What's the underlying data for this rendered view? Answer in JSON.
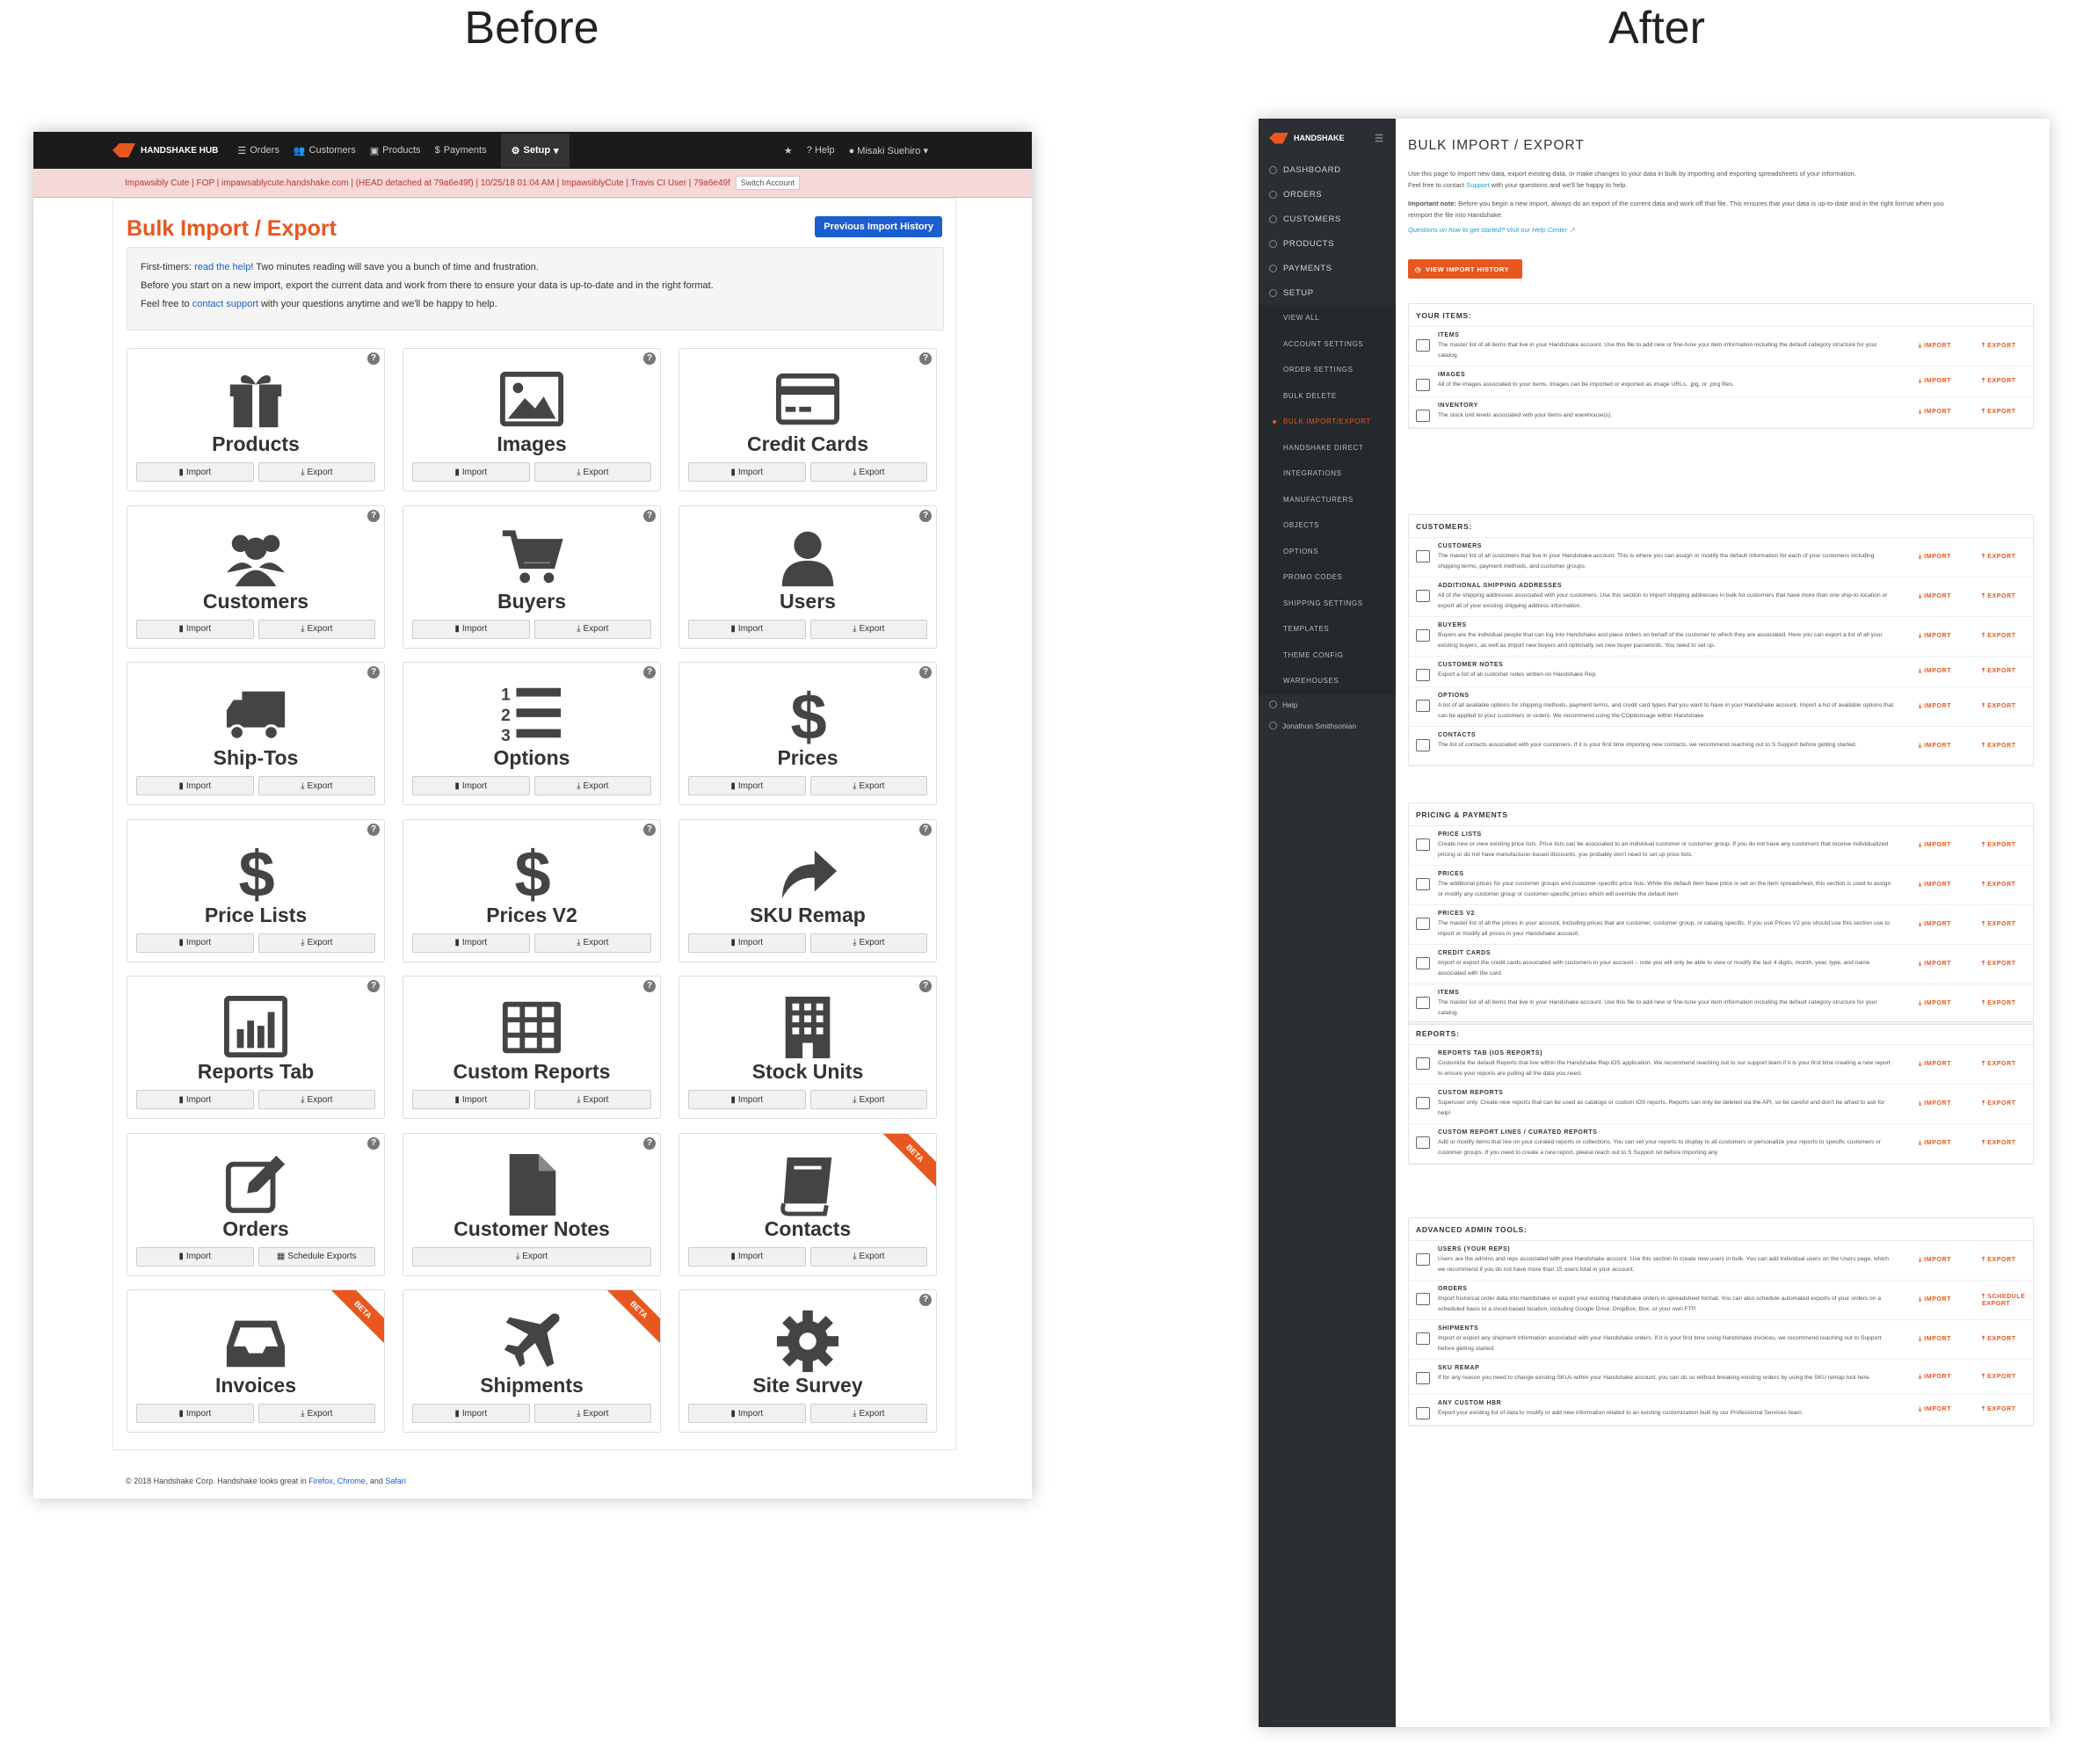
{
  "captions": {
    "before": "Before",
    "after": "After"
  },
  "before": {
    "brand": "HANDSHAKE HUB",
    "nav": [
      "Orders",
      "Customers",
      "Products",
      "Payments",
      "Setup"
    ],
    "nav_right": [
      "Help",
      "Misaki Suehiro"
    ],
    "env_bar": "Impawsibly Cute | FOP | impawsablycute.handshake.com | (HEAD detached at 79a6e49f) | 10/25/18 01:04 AM | ImpawsiblyCute | Travis CI User | 79a6e49f",
    "switch_account": "Switch Account",
    "title": "Bulk Import / Export",
    "history_button": "Previous Import History",
    "info": {
      "l1a": "First-timers: ",
      "l1link": "read the help",
      "l1b": "! Two minutes reading will save you a bunch of time and frustration.",
      "l2": "Before you start on a new import, export the current data and work from there to ensure your data is up-to-date and in the right format.",
      "l3a": "Feel free to ",
      "l3link": "contact support",
      "l3b": " with your questions anytime and we'll be happy to help."
    },
    "import_label": "Import",
    "export_label": "Export",
    "help_mark": "?",
    "beta_label": "BETA",
    "cards": [
      {
        "name": "Products",
        "icon": "gift-icon"
      },
      {
        "name": "Images",
        "icon": "image-icon"
      },
      {
        "name": "Credit Cards",
        "icon": "credit-card-icon"
      },
      {
        "name": "Customers",
        "icon": "group-icon"
      },
      {
        "name": "Buyers",
        "icon": "cart-icon"
      },
      {
        "name": "Users",
        "icon": "user-icon"
      },
      {
        "name": "Ship-Tos",
        "icon": "truck-icon"
      },
      {
        "name": "Options",
        "icon": "numbered-list-icon"
      },
      {
        "name": "Prices",
        "icon": "dollar-icon"
      },
      {
        "name": "Price Lists",
        "icon": "dollar-icon"
      },
      {
        "name": "Prices V2",
        "icon": "dollar-icon"
      },
      {
        "name": "SKU Remap",
        "icon": "share-arrow-icon"
      },
      {
        "name": "Reports Tab",
        "icon": "bar-chart-icon"
      },
      {
        "name": "Custom Reports",
        "icon": "table-icon"
      },
      {
        "name": "Stock Units",
        "icon": "building-icon"
      },
      {
        "name": "Orders",
        "icon": "edit-icon",
        "second": "Schedule Exports"
      },
      {
        "name": "Customer Notes",
        "icon": "file-icon",
        "only": "Export"
      },
      {
        "name": "Contacts",
        "icon": "book-icon",
        "beta": true
      },
      {
        "name": "Invoices",
        "icon": "inbox-icon",
        "beta": true
      },
      {
        "name": "Shipments",
        "icon": "plane-icon",
        "beta": true
      },
      {
        "name": "Site Survey",
        "icon": "gear-icon"
      }
    ],
    "footer": {
      "a": "© 2018 Handshake Corp.    Handshake looks great in ",
      "firefox": "Firefox",
      "chrome": "Chrome",
      "and": ", and ",
      "safari": "Safari"
    }
  },
  "after": {
    "brand": "HANDSHAKE",
    "nav": [
      "DASHBOARD",
      "ORDERS",
      "CUSTOMERS",
      "PRODUCTS",
      "PAYMENTS",
      "SETUP"
    ],
    "setup_sub": [
      "VIEW ALL",
      "ACCOUNT SETTINGS",
      "ORDER SETTINGS",
      "BULK DELETE",
      "BULK IMPORT/EXPORT",
      "HANDSHAKE DIRECT",
      "INTEGRATIONS",
      "MANUFACTURERS",
      "OBJECTS",
      "OPTIONS",
      "PROMO CODES",
      "SHIPPING SETTINGS",
      "TEMPLATES",
      "THEME CONFIG",
      "WAREHOUSES"
    ],
    "bottom": [
      "Help",
      "Jonathon Smithsonian"
    ],
    "title": "BULK IMPORT / EXPORT",
    "intro": {
      "p1a": "Use this page to import new data, export existing data, or make changes to your data in bulk by importing and exporting spreadsheets of your information.",
      "p1b": "Feel free to contact ",
      "p1link": "Support",
      "p1c": " with your questions and we'll be happy to help.",
      "p2label": "Important note:",
      "p2": " Before you begin a new import, always do an export of the current data and work off that file. This ensures that your data is up-to-date and in the right format when you reimport the file into Handshake.",
      "p3": "Questions on how to get started? Visit our Help Center"
    },
    "history_button": "VIEW IMPORT HISTORY",
    "import": "IMPORT",
    "export": "EXPORT",
    "sections": [
      {
        "title": "YOUR ITEMS:",
        "rows": [
          {
            "t": "ITEMS",
            "d": "The master list of all items that live in your Handshake account. Use this file to add new or fine-tune your item information including the default category structure for your catalog."
          },
          {
            "t": "IMAGES",
            "d": "All of the images associated to your items. Images can be imported or exported as image URLs, .jpg, or .png files."
          },
          {
            "t": "INVENTORY",
            "d": "The stock unit levels associated with your items and warehouse(s)."
          }
        ]
      },
      {
        "title": "CUSTOMERS:",
        "rows": [
          {
            "t": "CUSTOMERS",
            "d": "The master list of all customers that live in your Handshake account. This is where you can assign or modify the default information for each of your customers including shipping terms, payment methods, and customer groups."
          },
          {
            "t": "ADDITIONAL SHIPPING ADDRESSES",
            "d": "All of the shipping addresses associated with your customers. Use this section to import shipping addresses in bulk for customers that have more than one ship-to location or export all of your existing shipping address information."
          },
          {
            "t": "BUYERS",
            "d": "Buyers are the individual people that can log into Handshake and place orders on behalf of the customer to which they are associated. Here you can export a list of all your existing buyers, as well as import new buyers and optionally set new buyer passwords. You need to set up."
          },
          {
            "t": "CUSTOMER NOTES",
            "d": "Export a list of all customer notes written on Handshake Rep."
          },
          {
            "t": "OPTIONS",
            "d": "A list of all available options for shipping methods, payment terms, and credit card types that you want to have in your Handshake account. Import a list of available options that can be applied to your customers or orders. We recommend using the COptionsage within Handshake"
          },
          {
            "t": "CONTACTS",
            "d": "The list of contacts associated with your customers. If it is your first time importing new contacts, we recommend reaching out to S Support before getting started."
          }
        ]
      },
      {
        "title": "PRICING & PAYMENTS",
        "rows": [
          {
            "t": "PRICE LISTS",
            "d": "Create new or view existing price lists. Price lists can be associated to an individual customer or customer group. If you do not have any customers that receive individualized pricing or do not have manufacturer-based discounts, you probably don't need to set up price lists."
          },
          {
            "t": "PRICES",
            "d": "The additional prices for your customer groups and customer-specific price lists. While the default item base price is set on the item spreadsheet, this section is used to assign or modify any customer group or customer-specific prices which will override the default item"
          },
          {
            "t": "PRICES V2",
            "d": "The master list of all the prices in your account, including prices that are customer, customer group, or catalog specific. If you use Prices V2 you should use this section use to import or modify all prices in your Handshake account."
          },
          {
            "t": "CREDIT CARDS",
            "d": "Import or export the credit cards associated with customers in your account – note you will only be able to view or modify the last 4 digits, month, year, type, and name associated with the card."
          },
          {
            "t": "ITEMS",
            "d": "The master list of all items that live in your Handshake account. Use this file to add new or fine-tune your item information including the default category structure for your catalog."
          }
        ]
      },
      {
        "title": "REPORTS:",
        "rows": [
          {
            "t": "REPORTS TAB (IOS REPORTS)",
            "d": "Customize the default Reports that live within the Handshake Rep iOS application. We recommend reaching out to our support team if it is your first time creating a new report to ensure your reports are pulling all the data you need."
          },
          {
            "t": "CUSTOM REPORTS",
            "d": "Superuser only. Create new reports that can be used as catalogs or custom iOS reports. Reports can only be deleted via the API, so be careful and don't be afraid to ask for help!"
          },
          {
            "t": "CUSTOM REPORT LINES / CURATED REPORTS",
            "d": "Add or modify items that live on your curated reports or collections. You can set your reports to display to all customers or personalize your reports to specific customers or customer groups. If you need to create a new report, please reach out to S Support ret before importing any"
          }
        ]
      },
      {
        "title": "ADVANCED ADMIN TOOLS:",
        "rows": [
          {
            "t": "USERS (YOUR REPS)",
            "d": "Users are the admins and reps associated with your Handshake account. Use this section to create new users in bulk. You can add individual users on the Users page, which we recommend if you do not have more than 15 users total in your account."
          },
          {
            "t": "ORDERS",
            "d": "Import historical order data into Handshake or export your existing Handshake orders in spreadsheet format. You can also schedule automated exports of your orders on a scheduled basis to a cloud-based location, including Google Drive, DropBox, Box, or your own FTP.",
            "export": "SCHEDULE EXPORT"
          },
          {
            "t": "SHIPMENTS",
            "d": "Import or export any shipment information associated with your Handshake orders. If it is your first time using Handshake invoices, we recommend reaching out to Support before getting started."
          },
          {
            "t": "SKU REMAP",
            "d": "If for any reason you need to change existing SKUs within your Handshake account, you can do so without breaking existing orders by using the SKU remap tool here."
          },
          {
            "t": "ANY CUSTOM HBR",
            "d": "Export your existing list of data to modify or add new information related to an existing customization built by our Professional Services team."
          }
        ]
      }
    ]
  }
}
